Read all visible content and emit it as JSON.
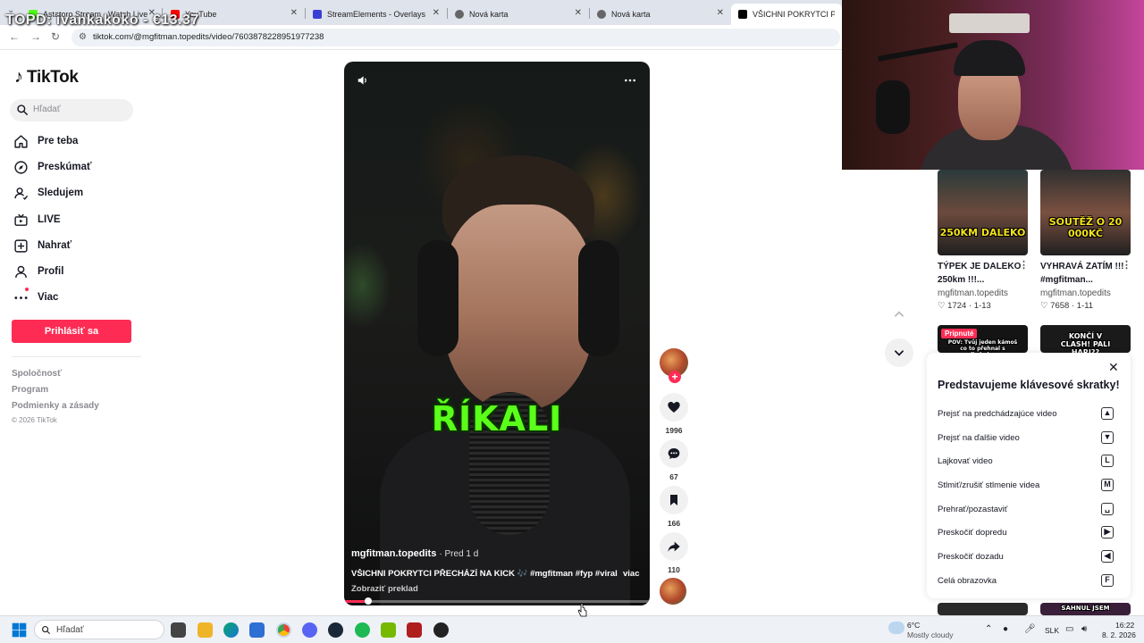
{
  "overlay": {
    "text": "TOPD: ivankakoko - €13.37"
  },
  "browser": {
    "tabs": [
      {
        "label": "Astatoro Stream - Watch Live o",
        "color": "#53fc18"
      },
      {
        "label": "YouTube",
        "color": "#ff0000"
      },
      {
        "label": "StreamElements - Overlays",
        "color": "#3a3fd4"
      },
      {
        "label": "Nová karta",
        "color": "#555555"
      },
      {
        "label": "Nová karta",
        "color": "#555555"
      },
      {
        "label": "VŠICHNI POKRYTCI PŘECHÁZ",
        "color": "#000000"
      }
    ],
    "url": "tiktok.com/@mgfitman.topedits/video/7603878228951977238"
  },
  "sidebar": {
    "logo": "TikTok",
    "search_placeholder": "Hľadať",
    "nav": [
      {
        "label": "Pre teba",
        "icon": "home-icon"
      },
      {
        "label": "Preskúmať",
        "icon": "compass-icon"
      },
      {
        "label": "Sledujem",
        "icon": "following-icon"
      },
      {
        "label": "LIVE",
        "icon": "live-icon"
      },
      {
        "label": "Nahrať",
        "icon": "upload-icon"
      },
      {
        "label": "Profil",
        "icon": "profile-icon"
      },
      {
        "label": "Viac",
        "icon": "more-icon"
      }
    ],
    "login": "Prihlásiť sa",
    "footer": [
      "Spoločnosť",
      "Program",
      "Podmienky a zásady"
    ],
    "copyright": "© 2026 TikTok"
  },
  "video": {
    "caption": "ŘÍKALI",
    "author": "mgfitman.topedits",
    "time": "· Pred 1 d",
    "description": "VŠICHNI POKRYTCI PŘECHÁZÍ NA KICK 🎶 #mgfitman #fyp #viral ...",
    "more": "viac",
    "translate": "Zobraziť preklad",
    "progress": 0.08
  },
  "actions": {
    "likes": "1996",
    "comments": "67",
    "saves": "166",
    "shares": "110"
  },
  "related": [
    {
      "thumb_text": "250KM DALEKO",
      "thumb_color": "#f5e21b",
      "title": "TÝPEK JE DALEKO 250km !!!...",
      "author": "mgfitman.topedits",
      "likes": "1724",
      "date": "1-13"
    },
    {
      "thumb_text": "SOUTĚŽ O 20 000KČ",
      "thumb_color": "#f5e21b",
      "title": "VYHRAVÁ ZATÍM !!! #mgfitman...",
      "author": "mgfitman.topedits",
      "likes": "7658",
      "date": "1-11"
    },
    {
      "pinned": "Pripnuté",
      "thumb_text": "POV: Tvůj jeden kámoš co to přehnal s alkoholem",
      "thumb_color": "#ffffff"
    },
    {
      "thumb_text": "KONČÍ V CLASH! PALI HARI??",
      "thumb_color": "#ffffff"
    },
    {
      "thumb_text": "",
      "thumb_color": "#ffffff"
    },
    {
      "thumb_text": "SAHNUL JSEM",
      "thumb_color": "#ffffff"
    }
  ],
  "shortcuts": {
    "title": "Predstavujeme klávesové skratky!",
    "rows": [
      {
        "label": "Prejsť na predchádzajúce video",
        "key": "▲"
      },
      {
        "label": "Prejsť na ďalšie video",
        "key": "▼"
      },
      {
        "label": "Lajkovať video",
        "key": "L"
      },
      {
        "label": "Stlmiť/zrušiť stlmenie videa",
        "key": "M"
      },
      {
        "label": "Prehrať/pozastaviť",
        "key": "␣"
      },
      {
        "label": "Preskočiť dopredu",
        "key": "▶"
      },
      {
        "label": "Preskočiť dozadu",
        "key": "◀"
      },
      {
        "label": "Celá obrazovka",
        "key": "F"
      }
    ]
  },
  "taskbar": {
    "search_placeholder": "Hľadať",
    "weather_temp": "6°C",
    "weather_desc": "Mostly cloudy",
    "lang": "SLK",
    "time": "16:22",
    "date": "8. 2. 2026"
  }
}
